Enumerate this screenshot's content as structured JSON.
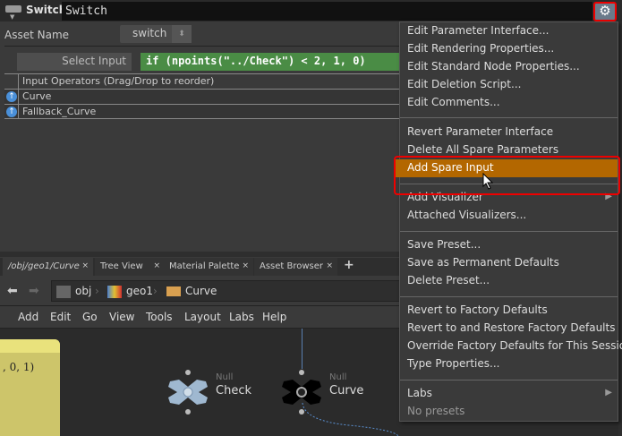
{
  "header": {
    "node_type": "Switch",
    "node_name": "Switch",
    "gear_icon": "gear-icon"
  },
  "params": {
    "asset_name_label": "Asset Name",
    "asset_name_value": "switch",
    "select_input_label": "Select Input",
    "select_input_expr": "if (npoints(\"../Check\") < 2, 1, 0)",
    "table_header": "Input Operators (Drag/Drop to reorder)",
    "rows": [
      "Curve",
      "Fallback_Curve"
    ]
  },
  "tabs": [
    {
      "label": "/obj/geo1/Curve"
    },
    {
      "label": "Tree View"
    },
    {
      "label": "Material Palette"
    },
    {
      "label": "Asset Browser"
    }
  ],
  "tab_add": "+",
  "tab_close": "×",
  "breadcrumbs": [
    "obj",
    "geo1",
    "Curve"
  ],
  "menubar": [
    "Add",
    "Edit",
    "Go",
    "View",
    "Tools",
    "Layout",
    "Labs",
    "Help"
  ],
  "sticky_text": ", 0, 1)",
  "nodes": [
    {
      "type": "Null",
      "name": "Check"
    },
    {
      "type": "Null",
      "name": "Curve"
    }
  ],
  "context_menu": {
    "items": [
      "Edit Parameter Interface...",
      "Edit Rendering Properties...",
      "Edit Standard Node Properties...",
      "Edit Deletion Script...",
      "Edit Comments...",
      "Revert Parameter Interface",
      "Delete All Spare Parameters",
      "Add Spare Input",
      "Add Visualizer",
      "Attached Visualizers...",
      "Save Preset...",
      "Save as Permanent Defaults",
      "Delete Preset...",
      "Revert to Factory Defaults",
      "Revert to and Restore Factory Defaults",
      "Override Factory Defaults for This Session",
      "Type Properties...",
      "Labs",
      "No presets"
    ],
    "highlighted": "Add Spare Input"
  },
  "colors": {
    "highlight": "#b36700",
    "expression": "#4a8c45",
    "annotation": "#ff0000"
  }
}
